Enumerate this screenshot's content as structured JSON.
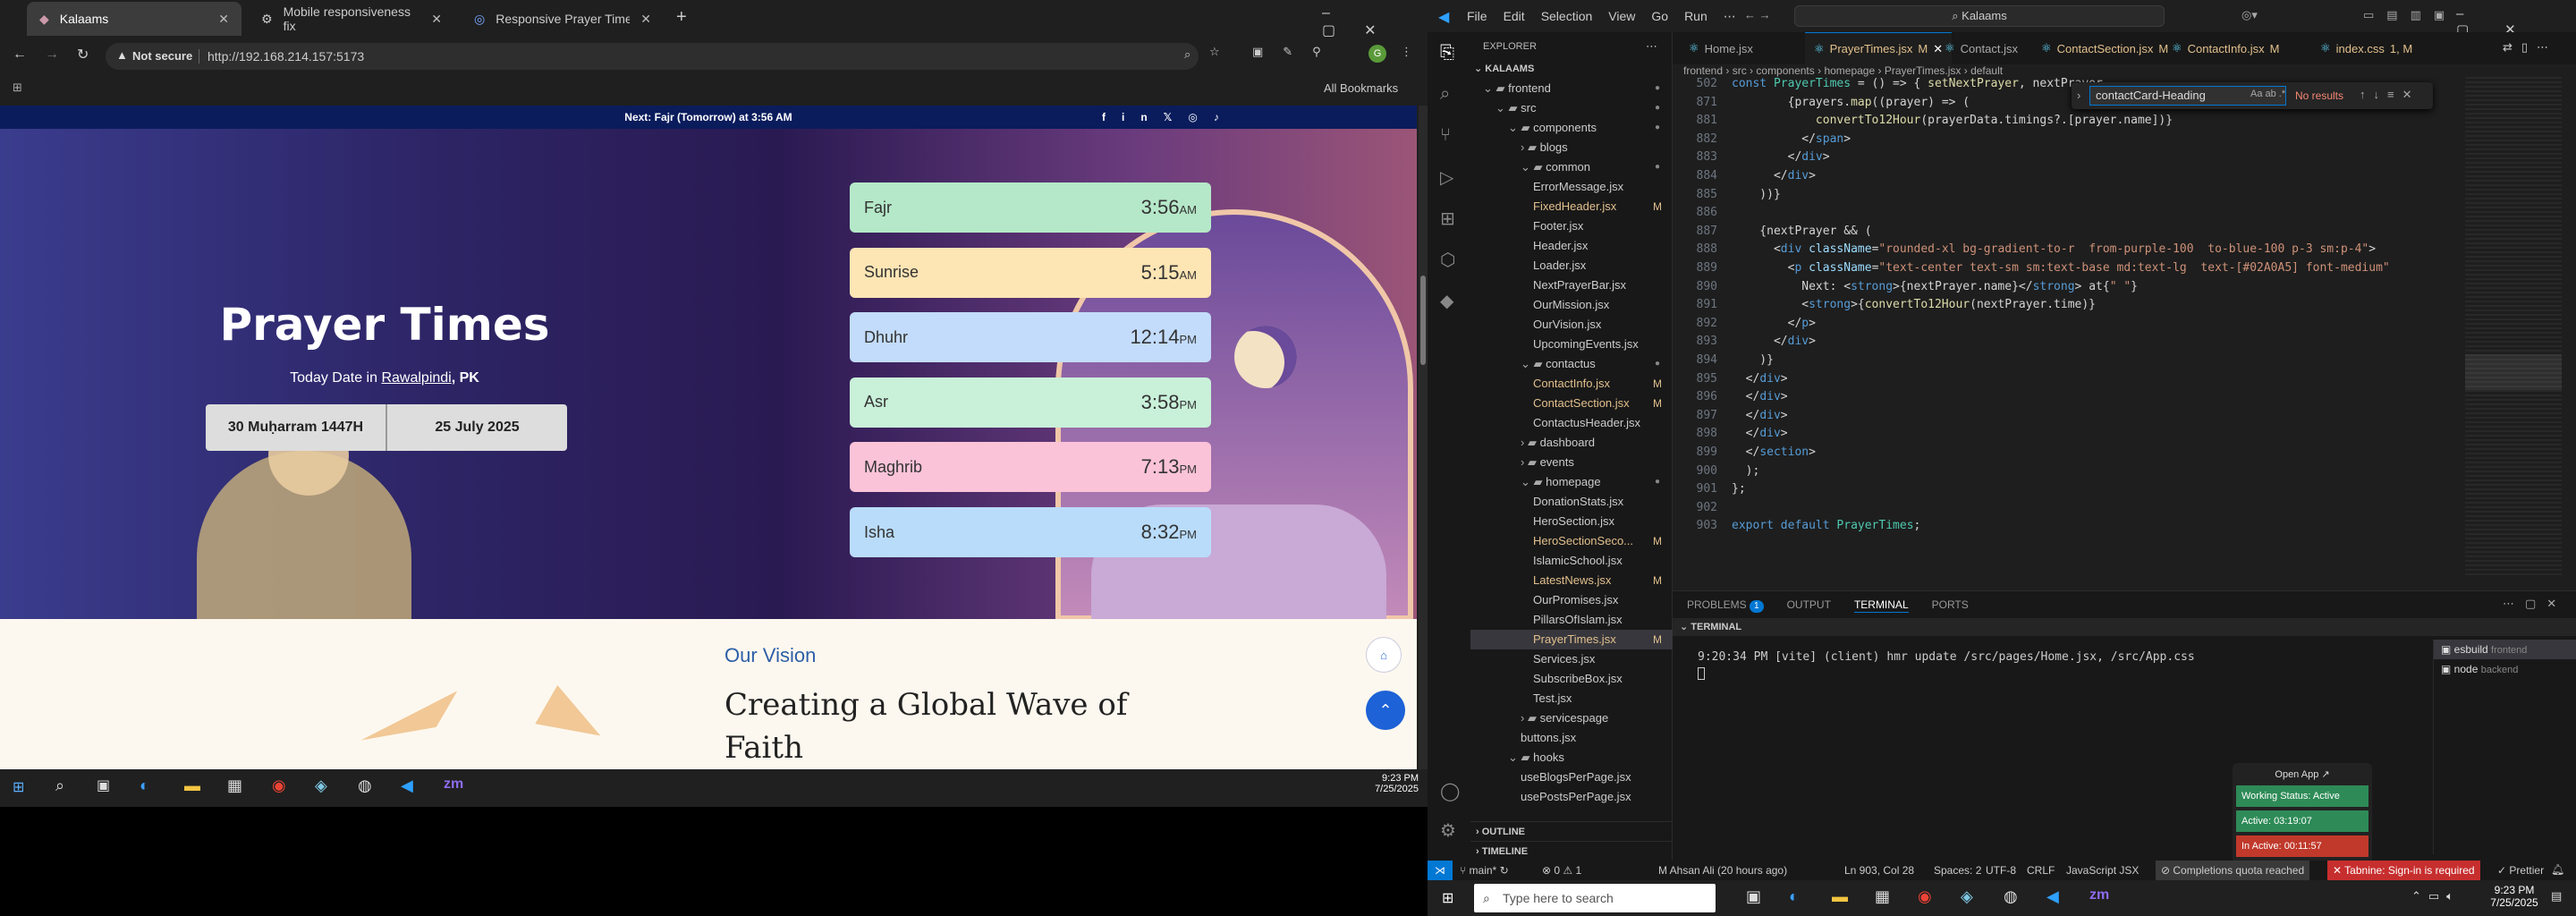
{
  "browser": {
    "tabs": [
      {
        "title": "Kalaams",
        "active": true
      },
      {
        "title": "Mobile responsiveness fix",
        "active": false
      },
      {
        "title": "Responsive Prayer Times Comp",
        "active": false
      }
    ],
    "new_tab": "+",
    "not_secure": "Not secure",
    "url": "http://192.168.214.157:5173",
    "all_bookmarks": "All Bookmarks"
  },
  "site": {
    "announcement": {
      "prefix": "Next:",
      "prayer": "Fajr (Tomorrow)",
      "at": "at 3:56 AM"
    },
    "social": [
      "f",
      "in",
      "𝕏",
      "◎",
      "♪"
    ],
    "title": "Prayer Times",
    "today_prefix": "Today Date in",
    "city": "Rawalpindi",
    "country": ", PK",
    "hijri_date": "30 Muḥarram 1447H",
    "greg_date": "25 July 2025",
    "prayers": [
      {
        "name": "Fajr",
        "time": "3:56",
        "ampm": "AM",
        "color": "#b5e8c8"
      },
      {
        "name": "Sunrise",
        "time": "5:15",
        "ampm": "AM",
        "color": "#fde5b4"
      },
      {
        "name": "Dhuhr",
        "time": "12:14",
        "ampm": "PM",
        "color": "#c3dcfb"
      },
      {
        "name": "Asr",
        "time": "3:58",
        "ampm": "PM",
        "color": "#c9f0d9"
      },
      {
        "name": "Maghrib",
        "time": "7:13",
        "ampm": "PM",
        "color": "#fbc3d8"
      },
      {
        "name": "Isha",
        "time": "8:32",
        "ampm": "PM",
        "color": "#b9dcfb"
      }
    ],
    "vision_label": "Our Vision",
    "vision_heading": "Creating a Global Wave of",
    "vision_heading_2": "Faith"
  },
  "win_taskbar_left": {
    "time": "9:23 PM",
    "date": "7/25/2025"
  },
  "vscode": {
    "menu": [
      "File",
      "Edit",
      "Selection",
      "View",
      "Go",
      "Run",
      "⋯"
    ],
    "search": "Kalaams",
    "explorer_title": "EXPLORER",
    "project": "KALAAMS",
    "tree": [
      {
        "label": "frontend",
        "indent": 1,
        "type": "open",
        "mark": "dot"
      },
      {
        "label": "src",
        "indent": 2,
        "type": "open",
        "mark": "dot"
      },
      {
        "label": "components",
        "indent": 3,
        "type": "open",
        "mark": "dot"
      },
      {
        "label": "blogs",
        "indent": 4,
        "type": "closed",
        "mark": ""
      },
      {
        "label": "common",
        "indent": 4,
        "type": "open",
        "mark": "dot"
      },
      {
        "label": "ErrorMessage.jsx",
        "indent": 5,
        "type": "file",
        "mark": ""
      },
      {
        "label": "FixedHeader.jsx",
        "indent": 5,
        "type": "file",
        "mark": "M"
      },
      {
        "label": "Footer.jsx",
        "indent": 5,
        "type": "file",
        "mark": ""
      },
      {
        "label": "Header.jsx",
        "indent": 5,
        "type": "file",
        "mark": ""
      },
      {
        "label": "Loader.jsx",
        "indent": 5,
        "type": "file",
        "mark": ""
      },
      {
        "label": "NextPrayerBar.jsx",
        "indent": 5,
        "type": "file",
        "mark": ""
      },
      {
        "label": "OurMission.jsx",
        "indent": 5,
        "type": "file",
        "mark": ""
      },
      {
        "label": "OurVision.jsx",
        "indent": 5,
        "type": "file",
        "mark": ""
      },
      {
        "label": "UpcomingEvents.jsx",
        "indent": 5,
        "type": "file",
        "mark": ""
      },
      {
        "label": "contactus",
        "indent": 4,
        "type": "open",
        "mark": "dot"
      },
      {
        "label": "ContactInfo.jsx",
        "indent": 5,
        "type": "file",
        "mark": "M"
      },
      {
        "label": "ContactSection.jsx",
        "indent": 5,
        "type": "file",
        "mark": "M"
      },
      {
        "label": "ContactusHeader.jsx",
        "indent": 5,
        "type": "file",
        "mark": ""
      },
      {
        "label": "dashboard",
        "indent": 4,
        "type": "closed",
        "mark": ""
      },
      {
        "label": "events",
        "indent": 4,
        "type": "closed",
        "mark": ""
      },
      {
        "label": "homepage",
        "indent": 4,
        "type": "open",
        "mark": "dot"
      },
      {
        "label": "DonationStats.jsx",
        "indent": 5,
        "type": "file",
        "mark": ""
      },
      {
        "label": "HeroSection.jsx",
        "indent": 5,
        "type": "file",
        "mark": ""
      },
      {
        "label": "HeroSectionSeco...",
        "indent": 5,
        "type": "file",
        "mark": "M"
      },
      {
        "label": "IslamicSchool.jsx",
        "indent": 5,
        "type": "file",
        "mark": ""
      },
      {
        "label": "LatestNews.jsx",
        "indent": 5,
        "type": "file",
        "mark": "M"
      },
      {
        "label": "OurPromises.jsx",
        "indent": 5,
        "type": "file",
        "mark": ""
      },
      {
        "label": "PillarsOfIslam.jsx",
        "indent": 5,
        "type": "file",
        "mark": ""
      },
      {
        "label": "PrayerTimes.jsx",
        "indent": 5,
        "type": "file",
        "mark": "M",
        "selected": true
      },
      {
        "label": "Services.jsx",
        "indent": 5,
        "type": "file",
        "mark": ""
      },
      {
        "label": "SubscribeBox.jsx",
        "indent": 5,
        "type": "file",
        "mark": ""
      },
      {
        "label": "Test.jsx",
        "indent": 5,
        "type": "file",
        "mark": ""
      },
      {
        "label": "servicespage",
        "indent": 4,
        "type": "closed",
        "mark": ""
      },
      {
        "label": "buttons.jsx",
        "indent": 4,
        "type": "file",
        "mark": ""
      },
      {
        "label": "hooks",
        "indent": 3,
        "type": "open",
        "mark": ""
      },
      {
        "label": "useBlogsPerPage.jsx",
        "indent": 4,
        "type": "file",
        "mark": ""
      },
      {
        "label": "usePostsPerPage.jsx",
        "indent": 4,
        "type": "file",
        "mark": ""
      }
    ],
    "outline": "OUTLINE",
    "timeline": "TIMELINE",
    "editor_tabs": [
      {
        "label": "Home.jsx",
        "mark": ""
      },
      {
        "label": "PrayerTimes.jsx",
        "mark": "M",
        "active": true
      },
      {
        "label": "Contact.jsx",
        "mark": ""
      },
      {
        "label": "ContactSection.jsx",
        "mark": "M"
      },
      {
        "label": "ContactInfo.jsx",
        "mark": "M"
      },
      {
        "label": "index.css",
        "mark": "1, M"
      }
    ],
    "breadcrumb": [
      "frontend",
      "src",
      "components",
      "homepage",
      "PrayerTimes.jsx",
      "default"
    ],
    "find": {
      "query": "contactCard-Heading",
      "result": "No results"
    },
    "sticky": [
      {
        "n": "502",
        "code": "const PrayerTimes = () => { setNextPrayer, nextPrayer"
      },
      {
        "n": "871",
        "code": "        {prayers.map((prayer) => ("
      }
    ],
    "lines": [
      {
        "n": "881",
        "code": "            convertTo12Hour(prayerData.timings?.[prayer.name])}"
      },
      {
        "n": "882",
        "code": "          </span>"
      },
      {
        "n": "883",
        "code": "        </div>"
      },
      {
        "n": "884",
        "code": "      </div>"
      },
      {
        "n": "885",
        "code": "    ))}"
      },
      {
        "n": "886",
        "code": ""
      },
      {
        "n": "887",
        "code": "    {nextPrayer && ("
      },
      {
        "n": "888",
        "code": "      <div className=\"rounded-xl bg-gradient-to-r  from-purple-100  to-blue-100 p-3 sm:p-4\">"
      },
      {
        "n": "889",
        "code": "        <p className=\"text-center text-sm sm:text-base md:text-lg  text-[#02A0A5] font-medium\""
      },
      {
        "n": "890",
        "code": "          Next: <strong>{nextPrayer.name}</strong> at{\" \"}"
      },
      {
        "n": "891",
        "code": "          <strong>{convertTo12Hour(nextPrayer.time)}"
      },
      {
        "n": "892",
        "code": "        </p>"
      },
      {
        "n": "893",
        "code": "      </div>"
      },
      {
        "n": "894",
        "code": "    )}"
      },
      {
        "n": "895",
        "code": "  </div>"
      },
      {
        "n": "896",
        "code": "  </div>"
      },
      {
        "n": "897",
        "code": "  </div>"
      },
      {
        "n": "898",
        "code": "  </div>"
      },
      {
        "n": "899",
        "code": "  </section>"
      },
      {
        "n": "900",
        "code": "  );"
      },
      {
        "n": "901",
        "code": "};"
      },
      {
        "n": "902",
        "code": ""
      },
      {
        "n": "903",
        "code": "export default PrayerTimes;"
      }
    ],
    "panel_tabs": [
      "PROBLEMS",
      "OUTPUT",
      "TERMINAL",
      "PORTS"
    ],
    "problems_count": "1",
    "terminal_label": "TERMINAL",
    "terminal_line": "9:20:34 PM [vite] (client) hmr update /src/pages/Home.jsx, /src/App.css",
    "terminals": [
      {
        "name": "esbuild",
        "dir": "frontend"
      },
      {
        "name": "node",
        "dir": "backend"
      }
    ],
    "open_app": "Open App ↗",
    "working_status": "Working Status: Active",
    "active": "Active: 03:19:07",
    "inactive": "In Active: 00:11:57",
    "status": {
      "branch": "main*",
      "errors": "⊗ 0 ⚠ 1",
      "blame": "M Ahsan Ali (20 hours ago)",
      "pos": "Ln 903, Col 28",
      "spaces": "Spaces: 2",
      "enc": "UTF-8",
      "eol": "CRLF",
      "lang": "JavaScript JSX",
      "quota": "Completions quota reached",
      "tabnine": "Tabnine: Sign-in is required",
      "prettier": "✓ Prettier"
    }
  },
  "win_taskbar": {
    "search": "Type here to search",
    "time": "9:23 PM",
    "date": "7/25/2025"
  }
}
